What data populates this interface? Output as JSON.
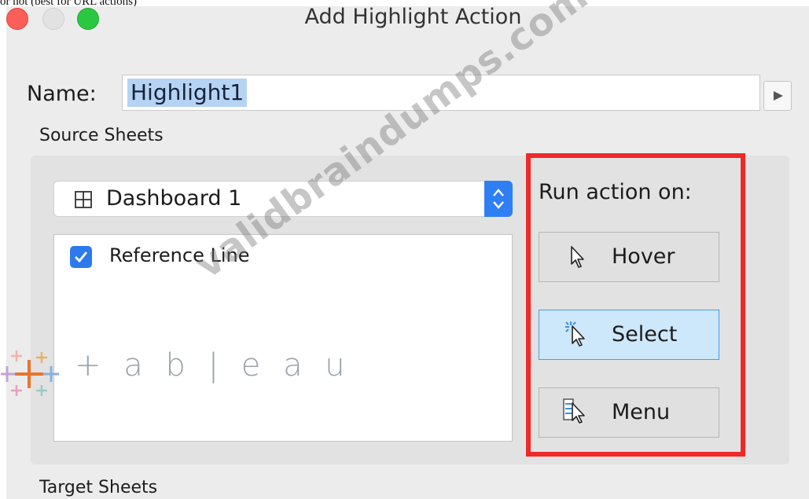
{
  "caption": "or not (best for URL actions)",
  "window": {
    "title": "Add Highlight Action"
  },
  "name_field": {
    "label": "Name:",
    "value": "Highlight1"
  },
  "source_sheets": {
    "label": "Source Sheets",
    "dropdown_value": "Dashboard 1",
    "sheets": [
      {
        "label": "Reference Line",
        "checked": true
      }
    ]
  },
  "run_action": {
    "label": "Run action on:",
    "buttons": [
      {
        "label": "Hover",
        "icon": "pointer-icon",
        "selected": false
      },
      {
        "label": "Select",
        "icon": "click-pointer-icon",
        "selected": true
      },
      {
        "label": "Menu",
        "icon": "menu-pointer-icon",
        "selected": false
      }
    ]
  },
  "target_sheets": {
    "label": "Target Sheets"
  },
  "overlays": {
    "logo": "+ a b | e a u",
    "watermark": "validbraindumps.com"
  },
  "colors": {
    "accent": "#2f7ff4",
    "highlight_frame": "#ee2a28",
    "selected_button": "#cde7fb"
  }
}
